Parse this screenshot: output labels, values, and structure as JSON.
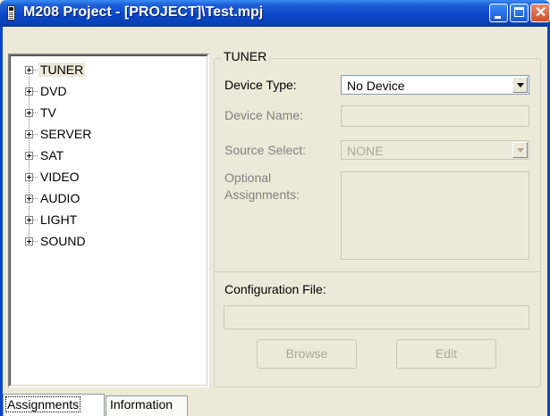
{
  "window": {
    "title": "M208 Project - [PROJECT]\\Test.mpj"
  },
  "tree": {
    "items": [
      {
        "label": "TUNER",
        "selected": true
      },
      {
        "label": "DVD"
      },
      {
        "label": "TV"
      },
      {
        "label": "SERVER"
      },
      {
        "label": "SAT"
      },
      {
        "label": "VIDEO"
      },
      {
        "label": "AUDIO"
      },
      {
        "label": "LIGHT"
      },
      {
        "label": "SOUND"
      }
    ]
  },
  "panel": {
    "group_title": "TUNER",
    "device_type_label": "Device Type:",
    "device_type_value": "No Device",
    "device_name_label": "Device Name:",
    "device_name_value": "",
    "source_select_label": "Source Select:",
    "source_select_value": "NONE",
    "optional_label_1": "Optional",
    "optional_label_2": "Assignments:",
    "config_label": "Configuration File:",
    "config_value": "",
    "browse_label": "Browse",
    "edit_label": "Edit"
  },
  "tabs": [
    {
      "label": "Assignments",
      "active": true
    },
    {
      "label": "Information"
    }
  ],
  "colors": {
    "titlebar": "#0a46c9",
    "window_bg": "#ece9d8",
    "close_button": "#d24b26"
  }
}
